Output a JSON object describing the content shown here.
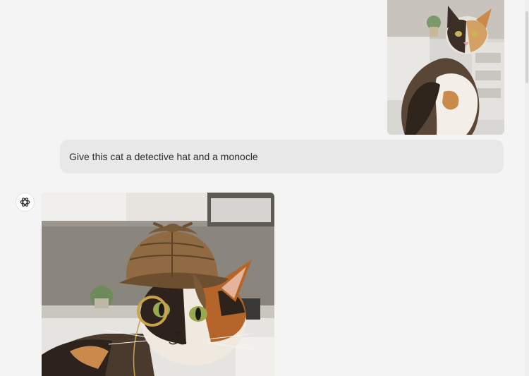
{
  "conversation": {
    "user_image_alt": "Calico cat sitting in a kitchen",
    "user_message": "Give this cat a detective hat and a monocle",
    "assistant_image_alt": "Calico cat wearing a tweed deerstalker detective hat and a gold monocle"
  },
  "icons": {
    "assistant_avatar": "openai-logo-icon"
  }
}
